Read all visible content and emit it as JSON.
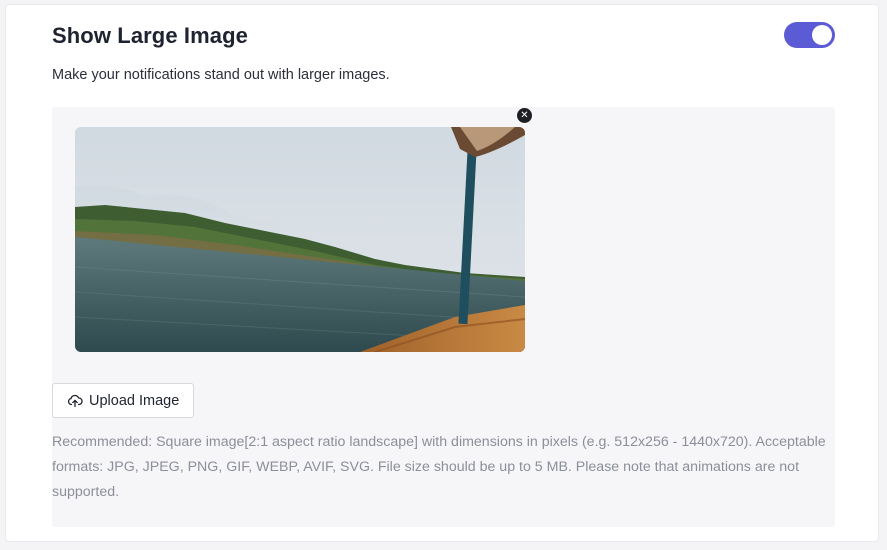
{
  "section": {
    "title": "Show Large Image",
    "description": "Make your notifications stand out with larger images.",
    "toggle": {
      "state": "on",
      "color": "#5b5bd6"
    }
  },
  "image_preview": {
    "remove_icon": "close-icon",
    "remove_glyph": "✕"
  },
  "upload": {
    "label": "Upload Image",
    "icon": "cloud-upload-icon"
  },
  "help": {
    "text": "Recommended: Square image[2:1 aspect ratio landscape] with dimensions in pixels (e.g. 512x256 - 1440x720). Acceptable formats: JPG, JPEG, PNG, GIF, WEBP, AVIF, SVG. File size should be up to 5 MB. Please note that animations are not supported."
  }
}
